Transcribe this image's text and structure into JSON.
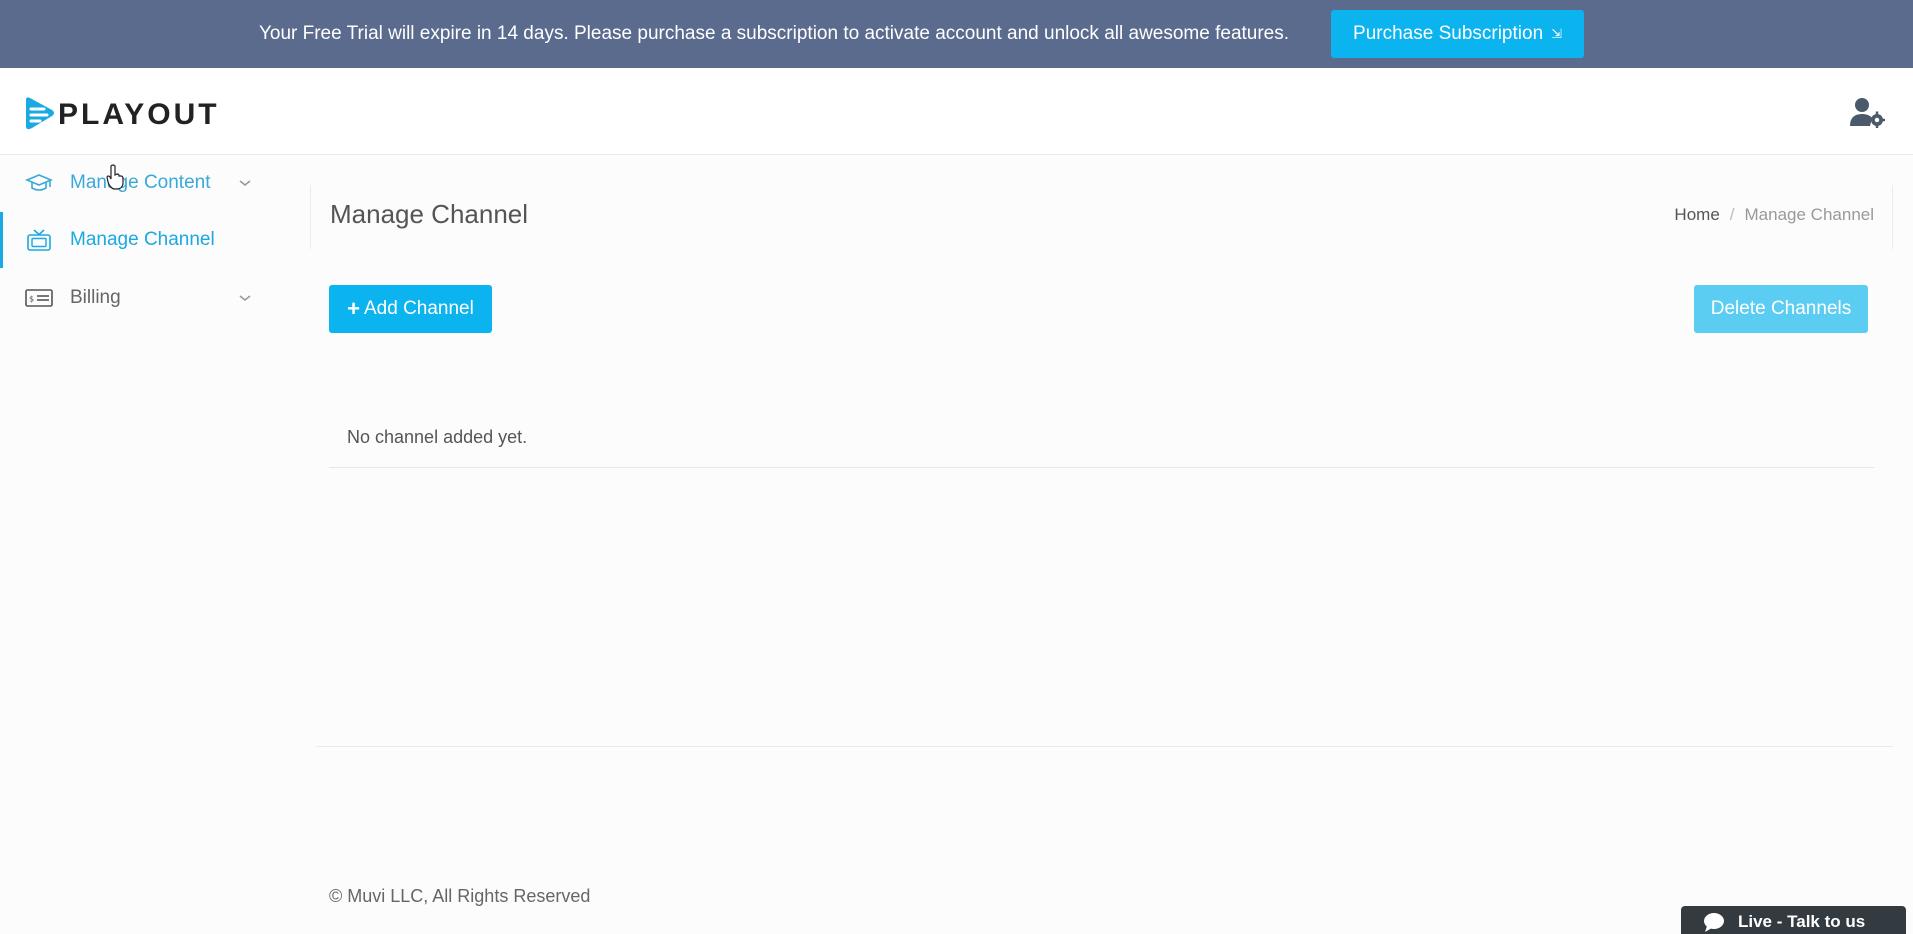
{
  "banner": {
    "message": "Your Free Trial will expire in 14 days. Please purchase a subscription to activate account and unlock all awesome features.",
    "purchase_label": "Purchase Subscription",
    "purchase_icon": "external-link-icon"
  },
  "header": {
    "logo_text": "PLAYOUT",
    "user_icon": "user-settings-icon"
  },
  "sidebar": {
    "items": [
      {
        "label": "Manage Content",
        "icon": "graduation-cap-icon",
        "expandable": true
      },
      {
        "label": "Manage Channel",
        "icon": "tv-icon",
        "active": true
      },
      {
        "label": "Billing",
        "icon": "billing-card-icon",
        "expandable": true
      }
    ]
  },
  "page": {
    "title": "Manage Channel",
    "breadcrumb": {
      "home": "Home",
      "separator": "/",
      "current": "Manage Channel"
    },
    "add_button": "Add Channel",
    "add_button_prefix": "+",
    "delete_button": "Delete Channels",
    "empty_message": "No channel added yet."
  },
  "footer": {
    "copyright": "© Muvi LLC, All Rights Reserved"
  },
  "chat": {
    "label": "Live - Talk to us"
  },
  "colors": {
    "banner_bg": "#5b6b8e",
    "accent": "#0bb3ef",
    "accent_disabled": "#5ccdf2",
    "active_link": "#1aa9e0"
  }
}
